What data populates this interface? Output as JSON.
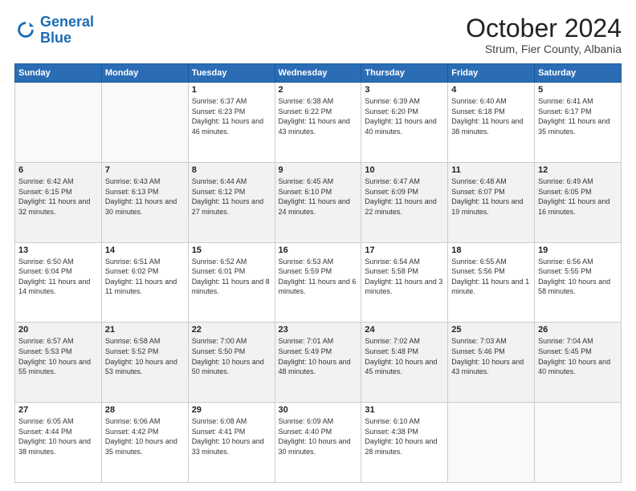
{
  "header": {
    "logo_line1": "General",
    "logo_line2": "Blue",
    "month": "October 2024",
    "location": "Strum, Fier County, Albania"
  },
  "weekdays": [
    "Sunday",
    "Monday",
    "Tuesday",
    "Wednesday",
    "Thursday",
    "Friday",
    "Saturday"
  ],
  "weeks": [
    [
      {
        "day": "",
        "sunrise": "",
        "sunset": "",
        "daylight": "",
        "empty": true
      },
      {
        "day": "",
        "sunrise": "",
        "sunset": "",
        "daylight": "",
        "empty": true
      },
      {
        "day": "1",
        "sunrise": "Sunrise: 6:37 AM",
        "sunset": "Sunset: 6:23 PM",
        "daylight": "Daylight: 11 hours and 46 minutes."
      },
      {
        "day": "2",
        "sunrise": "Sunrise: 6:38 AM",
        "sunset": "Sunset: 6:22 PM",
        "daylight": "Daylight: 11 hours and 43 minutes."
      },
      {
        "day": "3",
        "sunrise": "Sunrise: 6:39 AM",
        "sunset": "Sunset: 6:20 PM",
        "daylight": "Daylight: 11 hours and 40 minutes."
      },
      {
        "day": "4",
        "sunrise": "Sunrise: 6:40 AM",
        "sunset": "Sunset: 6:18 PM",
        "daylight": "Daylight: 11 hours and 38 minutes."
      },
      {
        "day": "5",
        "sunrise": "Sunrise: 6:41 AM",
        "sunset": "Sunset: 6:17 PM",
        "daylight": "Daylight: 11 hours and 35 minutes."
      }
    ],
    [
      {
        "day": "6",
        "sunrise": "Sunrise: 6:42 AM",
        "sunset": "Sunset: 6:15 PM",
        "daylight": "Daylight: 11 hours and 32 minutes."
      },
      {
        "day": "7",
        "sunrise": "Sunrise: 6:43 AM",
        "sunset": "Sunset: 6:13 PM",
        "daylight": "Daylight: 11 hours and 30 minutes."
      },
      {
        "day": "8",
        "sunrise": "Sunrise: 6:44 AM",
        "sunset": "Sunset: 6:12 PM",
        "daylight": "Daylight: 11 hours and 27 minutes."
      },
      {
        "day": "9",
        "sunrise": "Sunrise: 6:45 AM",
        "sunset": "Sunset: 6:10 PM",
        "daylight": "Daylight: 11 hours and 24 minutes."
      },
      {
        "day": "10",
        "sunrise": "Sunrise: 6:47 AM",
        "sunset": "Sunset: 6:09 PM",
        "daylight": "Daylight: 11 hours and 22 minutes."
      },
      {
        "day": "11",
        "sunrise": "Sunrise: 6:48 AM",
        "sunset": "Sunset: 6:07 PM",
        "daylight": "Daylight: 11 hours and 19 minutes."
      },
      {
        "day": "12",
        "sunrise": "Sunrise: 6:49 AM",
        "sunset": "Sunset: 6:05 PM",
        "daylight": "Daylight: 11 hours and 16 minutes."
      }
    ],
    [
      {
        "day": "13",
        "sunrise": "Sunrise: 6:50 AM",
        "sunset": "Sunset: 6:04 PM",
        "daylight": "Daylight: 11 hours and 14 minutes."
      },
      {
        "day": "14",
        "sunrise": "Sunrise: 6:51 AM",
        "sunset": "Sunset: 6:02 PM",
        "daylight": "Daylight: 11 hours and 11 minutes."
      },
      {
        "day": "15",
        "sunrise": "Sunrise: 6:52 AM",
        "sunset": "Sunset: 6:01 PM",
        "daylight": "Daylight: 11 hours and 8 minutes."
      },
      {
        "day": "16",
        "sunrise": "Sunrise: 6:53 AM",
        "sunset": "Sunset: 5:59 PM",
        "daylight": "Daylight: 11 hours and 6 minutes."
      },
      {
        "day": "17",
        "sunrise": "Sunrise: 6:54 AM",
        "sunset": "Sunset: 5:58 PM",
        "daylight": "Daylight: 11 hours and 3 minutes."
      },
      {
        "day": "18",
        "sunrise": "Sunrise: 6:55 AM",
        "sunset": "Sunset: 5:56 PM",
        "daylight": "Daylight: 11 hours and 1 minute."
      },
      {
        "day": "19",
        "sunrise": "Sunrise: 6:56 AM",
        "sunset": "Sunset: 5:55 PM",
        "daylight": "Daylight: 10 hours and 58 minutes."
      }
    ],
    [
      {
        "day": "20",
        "sunrise": "Sunrise: 6:57 AM",
        "sunset": "Sunset: 5:53 PM",
        "daylight": "Daylight: 10 hours and 55 minutes."
      },
      {
        "day": "21",
        "sunrise": "Sunrise: 6:58 AM",
        "sunset": "Sunset: 5:52 PM",
        "daylight": "Daylight: 10 hours and 53 minutes."
      },
      {
        "day": "22",
        "sunrise": "Sunrise: 7:00 AM",
        "sunset": "Sunset: 5:50 PM",
        "daylight": "Daylight: 10 hours and 50 minutes."
      },
      {
        "day": "23",
        "sunrise": "Sunrise: 7:01 AM",
        "sunset": "Sunset: 5:49 PM",
        "daylight": "Daylight: 10 hours and 48 minutes."
      },
      {
        "day": "24",
        "sunrise": "Sunrise: 7:02 AM",
        "sunset": "Sunset: 5:48 PM",
        "daylight": "Daylight: 10 hours and 45 minutes."
      },
      {
        "day": "25",
        "sunrise": "Sunrise: 7:03 AM",
        "sunset": "Sunset: 5:46 PM",
        "daylight": "Daylight: 10 hours and 43 minutes."
      },
      {
        "day": "26",
        "sunrise": "Sunrise: 7:04 AM",
        "sunset": "Sunset: 5:45 PM",
        "daylight": "Daylight: 10 hours and 40 minutes."
      }
    ],
    [
      {
        "day": "27",
        "sunrise": "Sunrise: 6:05 AM",
        "sunset": "Sunset: 4:44 PM",
        "daylight": "Daylight: 10 hours and 38 minutes."
      },
      {
        "day": "28",
        "sunrise": "Sunrise: 6:06 AM",
        "sunset": "Sunset: 4:42 PM",
        "daylight": "Daylight: 10 hours and 35 minutes."
      },
      {
        "day": "29",
        "sunrise": "Sunrise: 6:08 AM",
        "sunset": "Sunset: 4:41 PM",
        "daylight": "Daylight: 10 hours and 33 minutes."
      },
      {
        "day": "30",
        "sunrise": "Sunrise: 6:09 AM",
        "sunset": "Sunset: 4:40 PM",
        "daylight": "Daylight: 10 hours and 30 minutes."
      },
      {
        "day": "31",
        "sunrise": "Sunrise: 6:10 AM",
        "sunset": "Sunset: 4:38 PM",
        "daylight": "Daylight: 10 hours and 28 minutes."
      },
      {
        "day": "",
        "sunrise": "",
        "sunset": "",
        "daylight": "",
        "empty": true
      },
      {
        "day": "",
        "sunrise": "",
        "sunset": "",
        "daylight": "",
        "empty": true
      }
    ]
  ]
}
